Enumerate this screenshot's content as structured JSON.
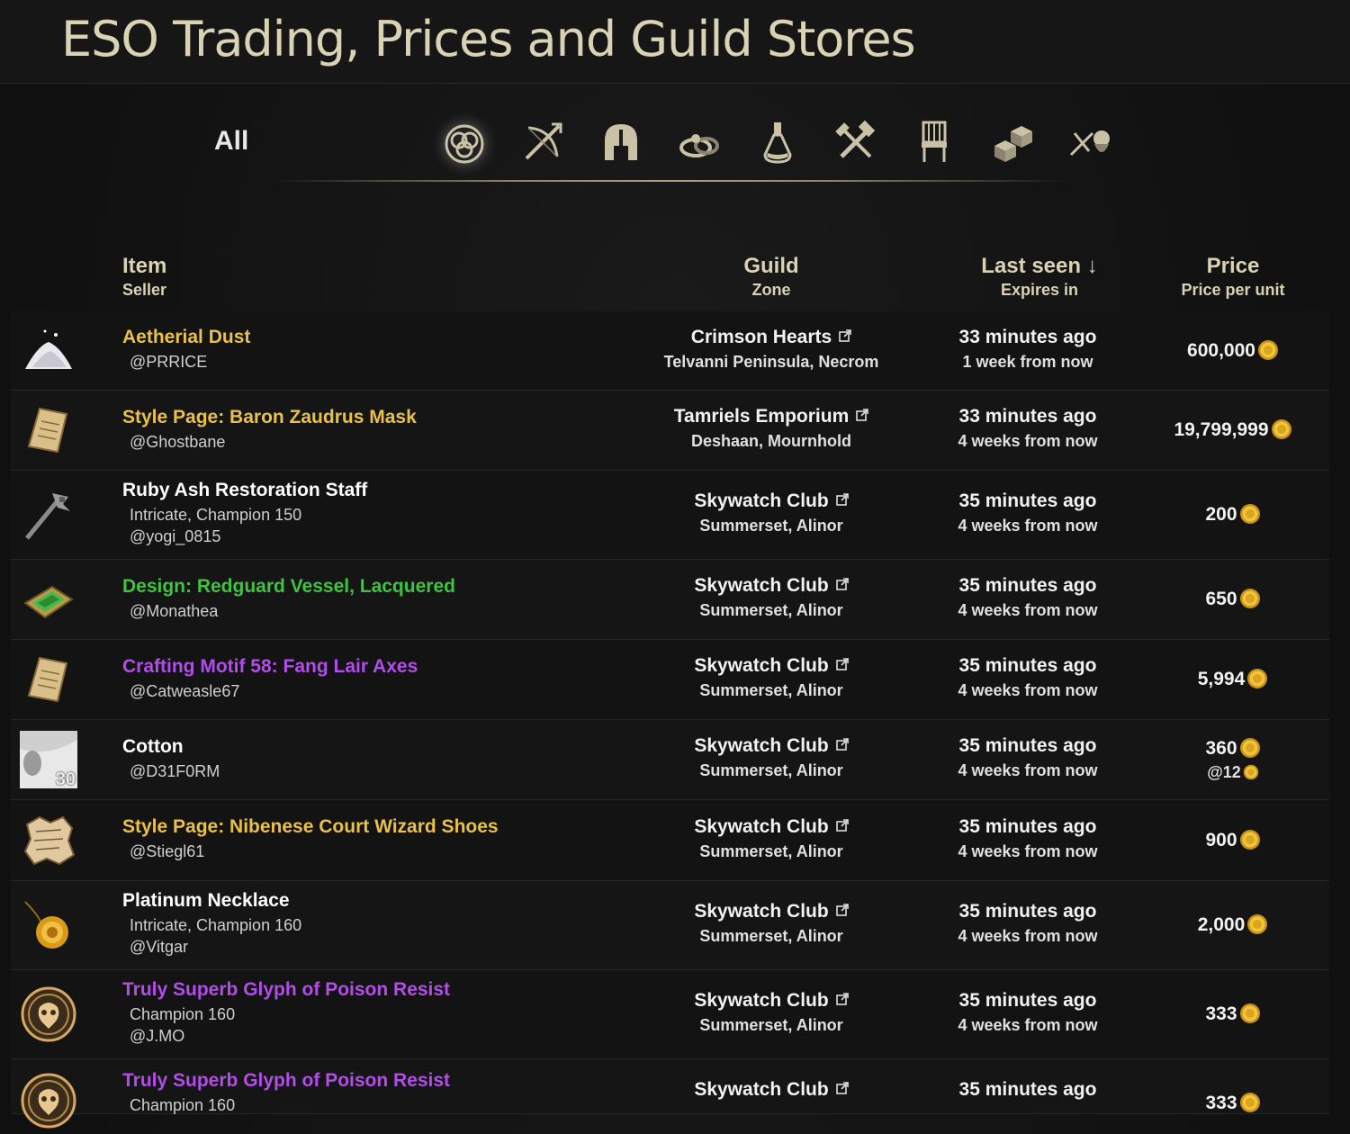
{
  "site": {
    "title": "ESO Trading, Prices and Guild Stores"
  },
  "categories": {
    "all_label": "All",
    "icons": [
      "all-items-icon",
      "weapons-icon",
      "armor-icon",
      "jewelry-icon",
      "consumables-icon",
      "crafting-icon",
      "furnishing-icon",
      "materials-icon",
      "misc-icon"
    ],
    "active": "all-items-icon"
  },
  "columns": {
    "item": "Item",
    "seller": "Seller",
    "guild": "Guild",
    "zone": "Zone",
    "last_seen": "Last seen ↓",
    "expires_in": "Expires in",
    "price": "Price",
    "price_per_unit": "Price per unit"
  },
  "colors": {
    "header_text": "#d9d2b4",
    "quality_legendary": "#e8c04a",
    "quality_epic": "#b34de8",
    "quality_fine": "#3ec43e",
    "quality_normal": "#ffffff",
    "coin": "#d9a520"
  },
  "listings": [
    {
      "name": "Aetherial Dust",
      "quality": "legendary",
      "icon": "dust-icon",
      "details": [],
      "seller": "@PRRICE",
      "guild": "Crimson Hearts",
      "zone": "Telvanni Peninsula, Necrom",
      "last_seen": "33 minutes ago",
      "expires": "1 week from now",
      "price": "600,000",
      "unit_price": ""
    },
    {
      "name": "Style Page: Baron Zaudrus Mask",
      "quality": "legendary",
      "icon": "scroll-icon",
      "details": [],
      "seller": "@Ghostbane",
      "guild": "Tamriels Emporium",
      "zone": "Deshaan, Mournhold",
      "last_seen": "33 minutes ago",
      "expires": "4 weeks from now",
      "price": "19,799,999",
      "unit_price": ""
    },
    {
      "name": "Ruby Ash Restoration Staff",
      "quality": "normal",
      "icon": "staff-icon",
      "details": [
        "Intricate, Champion 150"
      ],
      "seller": "@yogi_0815",
      "guild": "Skywatch Club",
      "zone": "Summerset, Alinor",
      "last_seen": "35 minutes ago",
      "expires": "4 weeks from now",
      "price": "200",
      "unit_price": ""
    },
    {
      "name": "Design: Redguard Vessel, Lacquered",
      "quality": "fine",
      "icon": "design-icon",
      "details": [],
      "seller": "@Monathea",
      "guild": "Skywatch Club",
      "zone": "Summerset, Alinor",
      "last_seen": "35 minutes ago",
      "expires": "4 weeks from now",
      "price": "650",
      "unit_price": ""
    },
    {
      "name": "Crafting Motif 58: Fang Lair Axes",
      "quality": "epic",
      "icon": "scroll-icon",
      "details": [],
      "seller": "@Catweasle67",
      "guild": "Skywatch Club",
      "zone": "Summerset, Alinor",
      "last_seen": "35 minutes ago",
      "expires": "4 weeks from now",
      "price": "5,994",
      "unit_price": ""
    },
    {
      "name": "Cotton",
      "quality": "normal",
      "icon": "cloth-icon",
      "quantity": "30",
      "details": [],
      "seller": "@D31F0RM",
      "guild": "Skywatch Club",
      "zone": "Summerset, Alinor",
      "last_seen": "35 minutes ago",
      "expires": "4 weeks from now",
      "price": "360",
      "unit_price": "@12"
    },
    {
      "name": "Style Page: Nibenese Court Wizard Shoes",
      "quality": "legendary",
      "icon": "torn-page-icon",
      "details": [],
      "seller": "@Stiegl61",
      "guild": "Skywatch Club",
      "zone": "Summerset, Alinor",
      "last_seen": "35 minutes ago",
      "expires": "4 weeks from now",
      "price": "900",
      "unit_price": ""
    },
    {
      "name": "Platinum Necklace",
      "quality": "normal",
      "icon": "necklace-icon",
      "details": [
        "Intricate, Champion 160"
      ],
      "seller": "@Vitgar",
      "guild": "Skywatch Club",
      "zone": "Summerset, Alinor",
      "last_seen": "35 minutes ago",
      "expires": "4 weeks from now",
      "price": "2,000",
      "unit_price": ""
    },
    {
      "name": "Truly Superb Glyph of Poison Resist",
      "quality": "epic",
      "icon": "glyph-icon",
      "details": [
        "Champion 160"
      ],
      "seller": "@J.MO",
      "guild": "Skywatch Club",
      "zone": "Summerset, Alinor",
      "last_seen": "35 minutes ago",
      "expires": "4 weeks from now",
      "price": "333",
      "unit_price": ""
    },
    {
      "name": "Truly Superb Glyph of Poison Resist",
      "quality": "epic",
      "icon": "glyph-icon",
      "details": [
        "Champion 160"
      ],
      "seller": "",
      "guild": "Skywatch Club",
      "zone": "",
      "last_seen": "35 minutes ago",
      "expires": "",
      "price": "333",
      "unit_price": ""
    }
  ]
}
